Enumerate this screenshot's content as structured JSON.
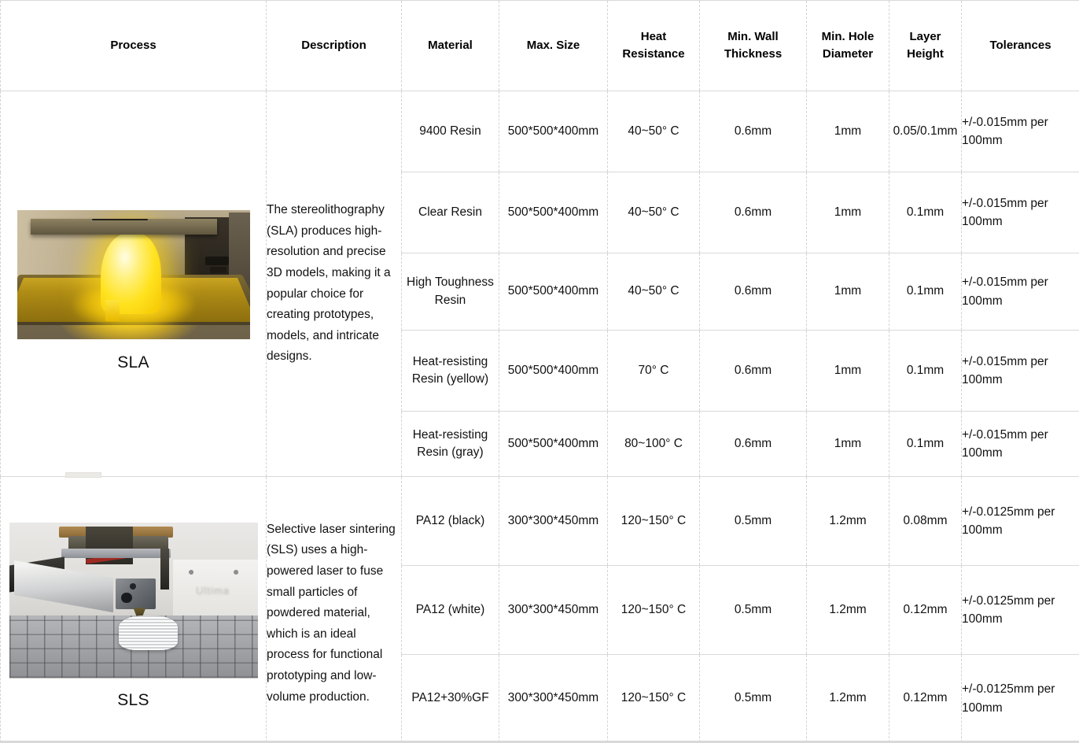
{
  "table": {
    "columns": [
      {
        "id": "process",
        "label": "Process",
        "label2": ""
      },
      {
        "id": "description",
        "label": "Description",
        "label2": ""
      },
      {
        "id": "material",
        "label": "Material",
        "label2": ""
      },
      {
        "id": "max_size",
        "label": "Max. Size",
        "label2": ""
      },
      {
        "id": "heat_resistance",
        "label": "Heat",
        "label2": "Resistance"
      },
      {
        "id": "min_wall_thickness",
        "label": "Min. Wall",
        "label2": "Thickness"
      },
      {
        "id": "min_hole_diameter",
        "label": "Min. Hole",
        "label2": "Diameter"
      },
      {
        "id": "layer_height",
        "label": "Layer",
        "label2": "Height"
      },
      {
        "id": "tolerances",
        "label": "Tolerances",
        "label2": ""
      }
    ],
    "groups": [
      {
        "process_label": "SLA",
        "process_image": "sla-resin-printer-photo",
        "description": "The stereolithography (SLA) produces high-resolution and precise 3D models, making it a popular choice for creating prototypes, models, and intricate designs.",
        "rows": [
          {
            "material": "9400 Resin",
            "max_size": "500*500*400mm",
            "heat_resistance": "40~50° C",
            "min_wall_thickness": "0.6mm",
            "min_hole_diameter": "1mm",
            "layer_height": "0.05/0.1mm",
            "tolerances": "+/-0.015mm per 100mm"
          },
          {
            "material": "Clear Resin",
            "max_size": "500*500*400mm",
            "heat_resistance": "40~50° C",
            "min_wall_thickness": "0.6mm",
            "min_hole_diameter": "1mm",
            "layer_height": "0.1mm",
            "tolerances": "+/-0.015mm per 100mm"
          },
          {
            "material": "High Toughness Resin",
            "max_size": "500*500*400mm",
            "heat_resistance": "40~50° C",
            "min_wall_thickness": "0.6mm",
            "min_hole_diameter": "1mm",
            "layer_height": "0.1mm",
            "tolerances": "+/-0.015mm per 100mm"
          },
          {
            "material": "Heat-resisting Resin (yellow)",
            "max_size": "500*500*400mm",
            "heat_resistance": "70° C",
            "min_wall_thickness": "0.6mm",
            "min_hole_diameter": "1mm",
            "layer_height": "0.1mm",
            "tolerances": "+/-0.015mm per 100mm"
          },
          {
            "material": "Heat-resisting Resin (gray)",
            "max_size": "500*500*400mm",
            "heat_resistance": "80~100° C",
            "min_wall_thickness": "0.6mm",
            "min_hole_diameter": "1mm",
            "layer_height": "0.1mm",
            "tolerances": "+/-0.015mm per 100mm"
          }
        ]
      },
      {
        "process_label": "SLS",
        "process_image": "sls-printer-nozzle-photo",
        "description": "Selective laser sintering (SLS) uses a high-powered laser to fuse small particles of powdered material, which is an ideal process for functional prototyping and low-volume production.",
        "rows": [
          {
            "material": "PA12 (black)",
            "max_size": "300*300*450mm",
            "heat_resistance": "120~150° C",
            "min_wall_thickness": "0.5mm",
            "min_hole_diameter": "1.2mm",
            "layer_height": "0.08mm",
            "tolerances": "+/-0.0125mm per 100mm"
          },
          {
            "material": "PA12 (white)",
            "max_size": "300*300*450mm",
            "heat_resistance": "120~150° C",
            "min_wall_thickness": "0.5mm",
            "min_hole_diameter": "1.2mm",
            "layer_height": "0.12mm",
            "tolerances": "+/-0.0125mm per 100mm"
          },
          {
            "material": "PA12+30%GF",
            "max_size": "300*300*450mm",
            "heat_resistance": "120~150° C",
            "min_wall_thickness": "0.5mm",
            "min_hole_diameter": "1.2mm",
            "layer_height": "0.12mm",
            "tolerances": "+/-0.0125mm per 100mm"
          }
        ]
      }
    ]
  },
  "colors": {
    "header_bg": "#f0f0f0",
    "grid": "#d9d9d9",
    "text": "#111111"
  }
}
